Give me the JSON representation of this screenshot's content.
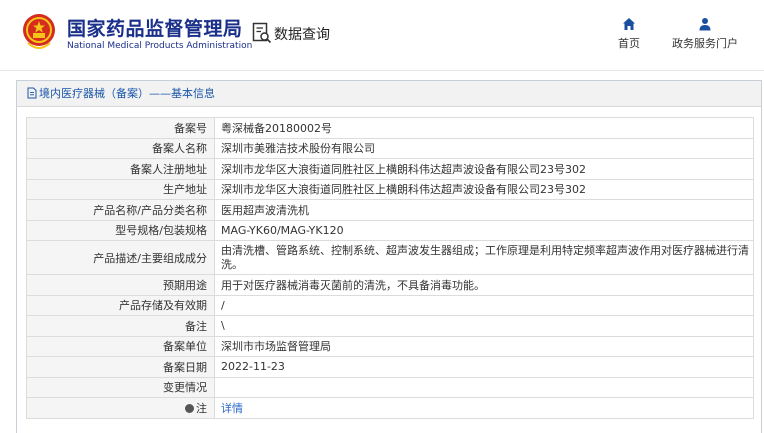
{
  "header": {
    "org_name_cn": "国家药品监督管理局",
    "org_name_en": "National Medical Products Administration",
    "query_label": "数据查询"
  },
  "nav": {
    "home_label": "首页",
    "portal_label": "政务服务门户"
  },
  "panel": {
    "title": "境内医疗器械（备案）——基本信息"
  },
  "rows": [
    {
      "label": "备案号",
      "value": "粤深械备20180002号"
    },
    {
      "label": "备案人名称",
      "value": "深圳市美雅洁技术股份有限公司"
    },
    {
      "label": "备案人注册地址",
      "value": "深圳市龙华区大浪街道同胜社区上横朗科伟达超声波设备有限公司23号302"
    },
    {
      "label": "生产地址",
      "value": "深圳市龙华区大浪街道同胜社区上横朗科伟达超声波设备有限公司23号302"
    },
    {
      "label": "产品名称/产品分类名称",
      "value": "医用超声波清洗机"
    },
    {
      "label": "型号规格/包装规格",
      "value": "MAG-YK60/MAG-YK120"
    },
    {
      "label": "产品描述/主要组成成分",
      "value": "由清洗槽、管路系统、控制系统、超声波发生器组成；工作原理是利用特定频率超声波作用对医疗器械进行清洗。"
    },
    {
      "label": "预期用途",
      "value": "用于对医疗器械消毒灭菌前的清洗，不具备消毒功能。"
    },
    {
      "label": "产品存储及有效期",
      "value": "/"
    },
    {
      "label": "备注",
      "value": "\\"
    },
    {
      "label": "备案单位",
      "value": "深圳市市场监督管理局"
    },
    {
      "label": "备案日期",
      "value": "2022-11-23"
    },
    {
      "label": "变更情况",
      "value": ""
    },
    {
      "label": "注",
      "value": "详情"
    }
  ],
  "colors": {
    "brand_blue": "#1a2f8a",
    "link_blue": "#2a68c8",
    "emblem_red": "#d62b1f",
    "emblem_gold": "#f5c518"
  }
}
